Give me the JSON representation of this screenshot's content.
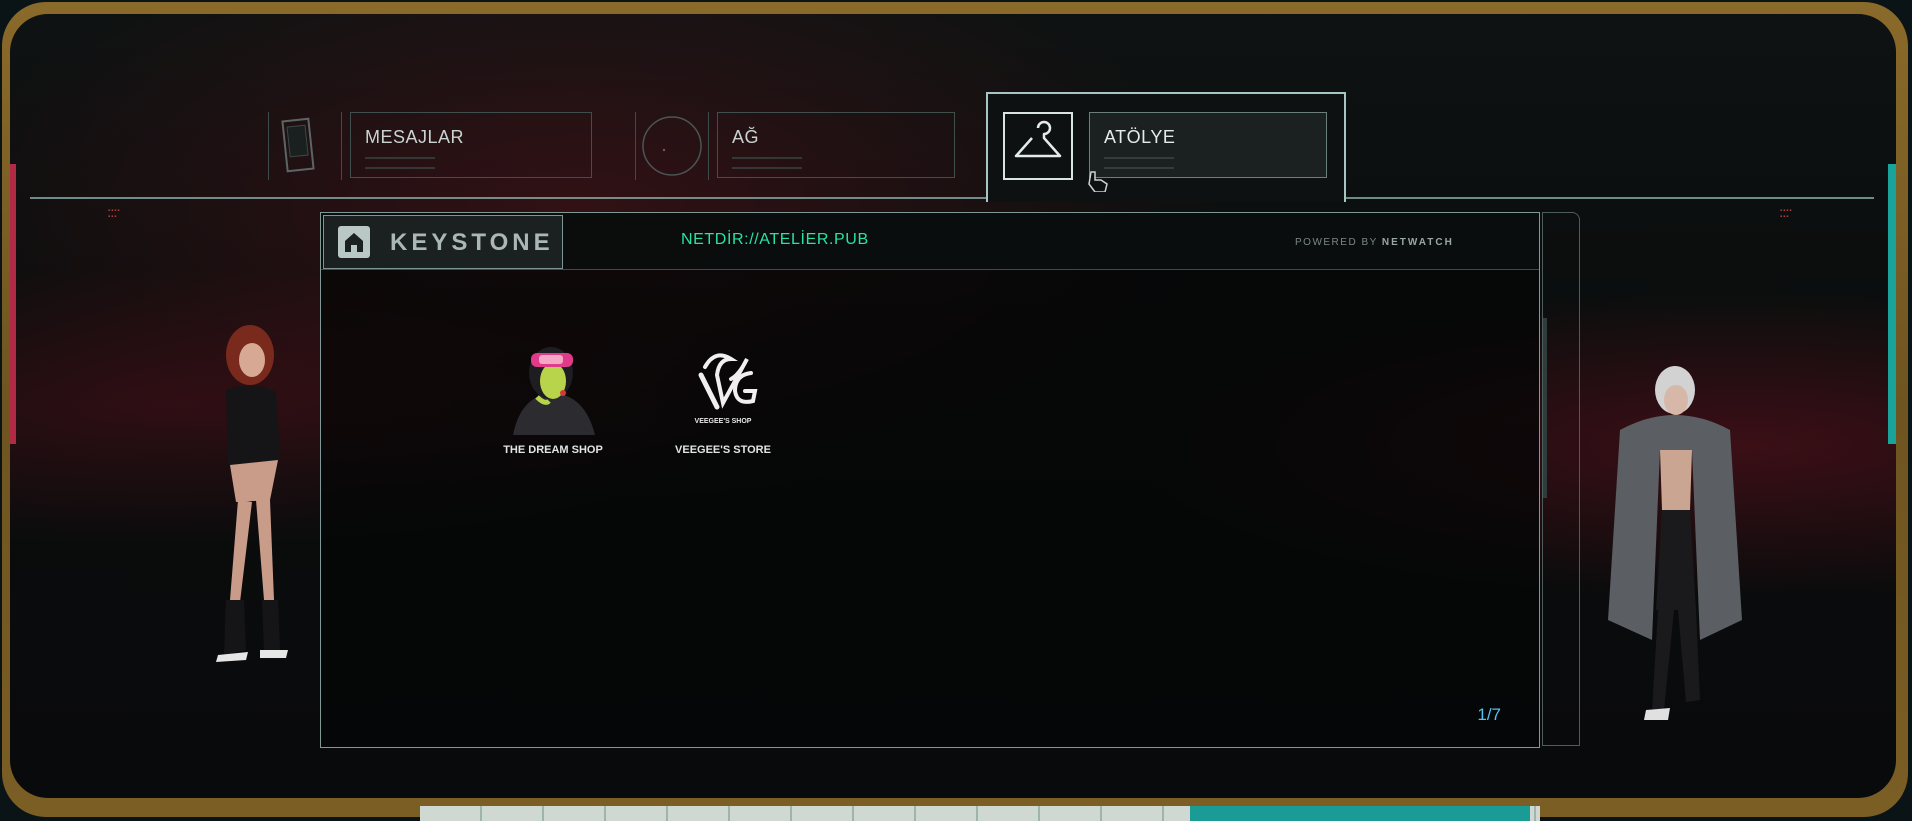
{
  "tabs": [
    {
      "label": "MESAJLAR",
      "icon": "phone-icon",
      "active": false
    },
    {
      "label": "AĞ",
      "icon": "network-circle-icon",
      "active": false
    },
    {
      "label": "ATÖLYE",
      "icon": "hanger-icon",
      "active": true
    }
  ],
  "browser": {
    "logo_text": "KEYSTONE",
    "url": "NETDİR://ATELİER.PUB",
    "powered_by": "POWERED BY",
    "powered_brand": "NETWATCH",
    "page_indicator": "1/7"
  },
  "shops": [
    {
      "name": "THE DREAM SHOP",
      "icon": "dream-shop-avatar-icon"
    },
    {
      "name": "VEEGEE'S STORE",
      "icon": "veegee-logo-icon",
      "logo_caption": "VEEGEE'S SHOP"
    }
  ],
  "colors": {
    "accent_green": "#29e3a0",
    "page_blue": "#58c0ee",
    "frame_gold": "#7b5e24",
    "teal": "#1aa39a",
    "magenta": "#b02a46"
  }
}
